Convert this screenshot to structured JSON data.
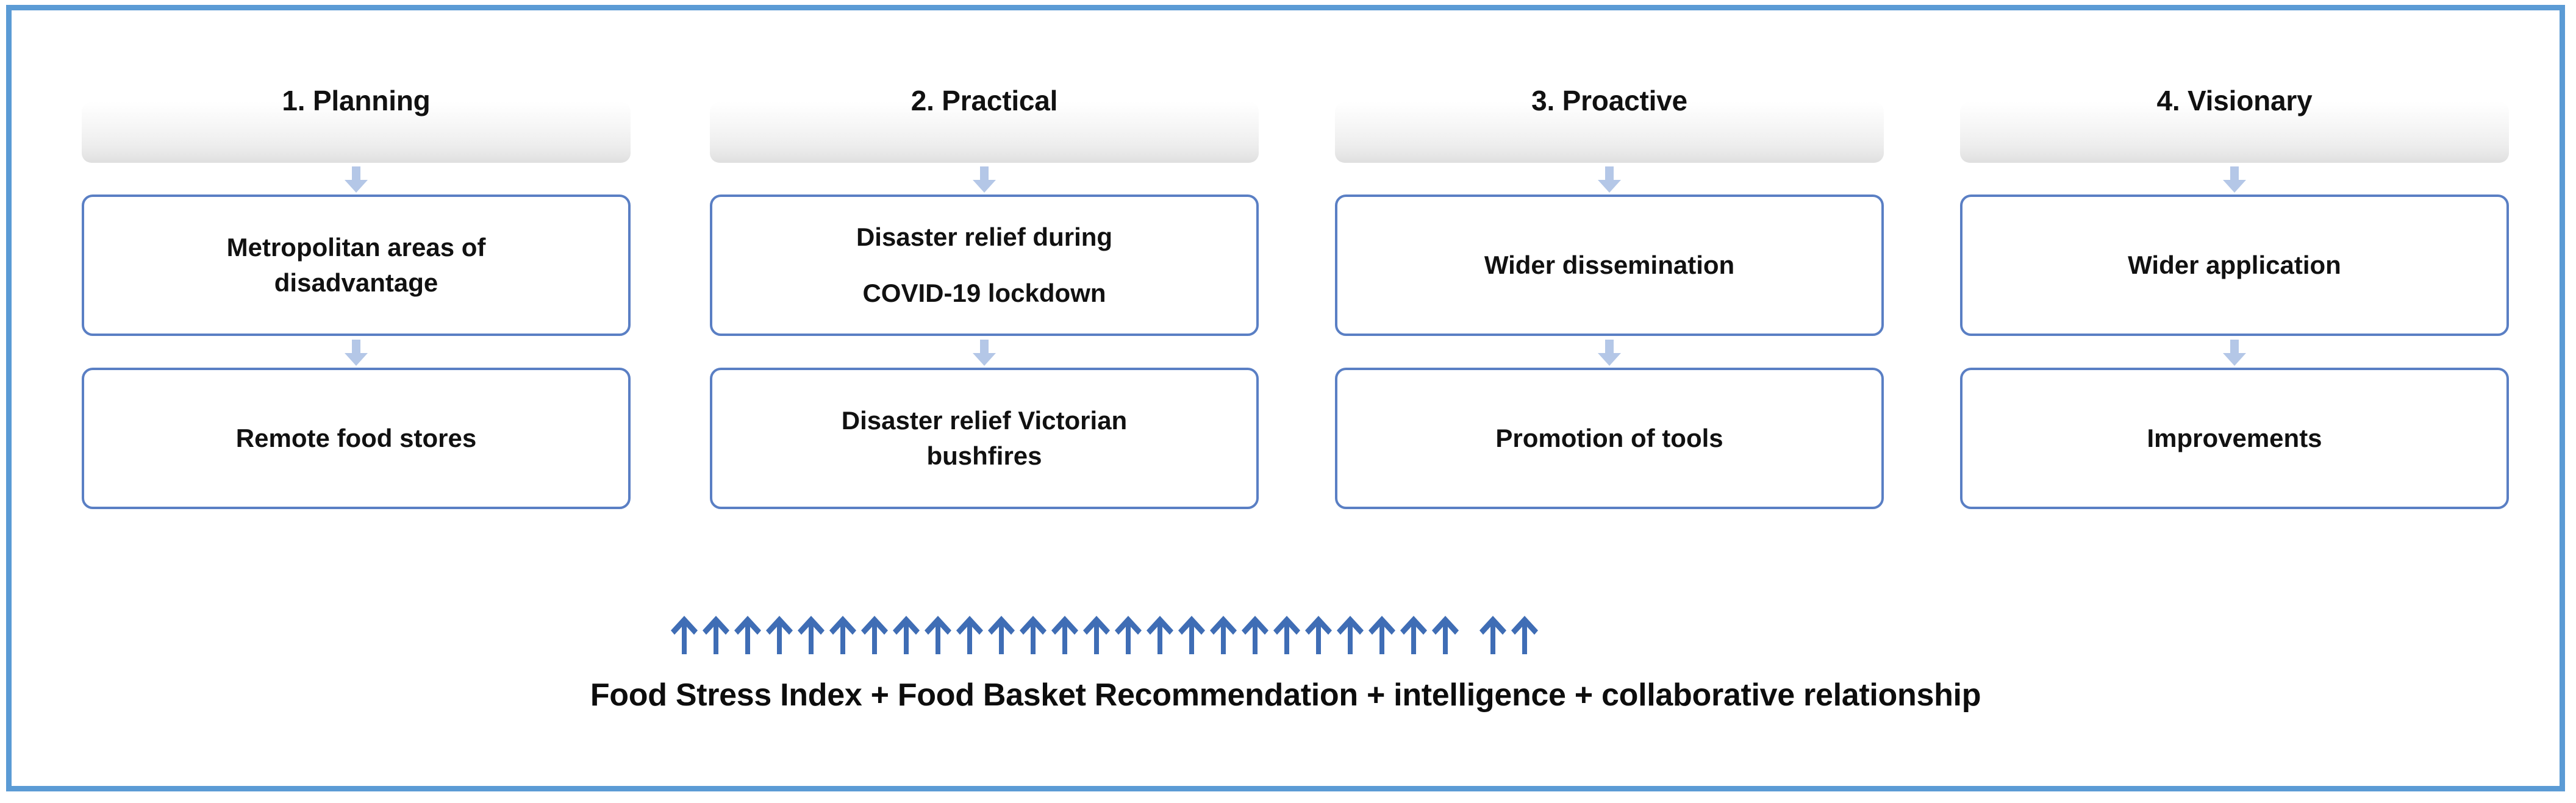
{
  "frame": {
    "border_color": "#5b9bd5",
    "background": "#ffffff"
  },
  "style": {
    "node_border_color": "#5a7fc4",
    "connector_arrow_color": "#b4c7e7",
    "bottom_arrow_color": "#3f6db5",
    "header_gradient_from": "#ffffff",
    "header_gradient_to": "#dedede",
    "text_color": "#111111"
  },
  "columns": [
    {
      "header": "1. Planning",
      "nodes": [
        "Metropolitan areas of\ndisadvantage",
        "Remote food stores"
      ]
    },
    {
      "header": "2. Practical",
      "nodes": [
        "Disaster relief during\nCOVID-19 lockdown",
        "Disaster relief Victorian\nbushfires"
      ]
    },
    {
      "header": "3. Proactive",
      "nodes": [
        "Wider dissemination",
        "Promotion of tools"
      ]
    },
    {
      "header": "4. Visionary",
      "nodes": [
        "Wider application",
        "Improvements"
      ]
    }
  ],
  "foundation": {
    "arrow_count": 27,
    "arrow_icon": "arrow-up-icon",
    "caption": "Food Stress Index + Food Basket Recommendation + intelligence + collaborative relationship"
  }
}
